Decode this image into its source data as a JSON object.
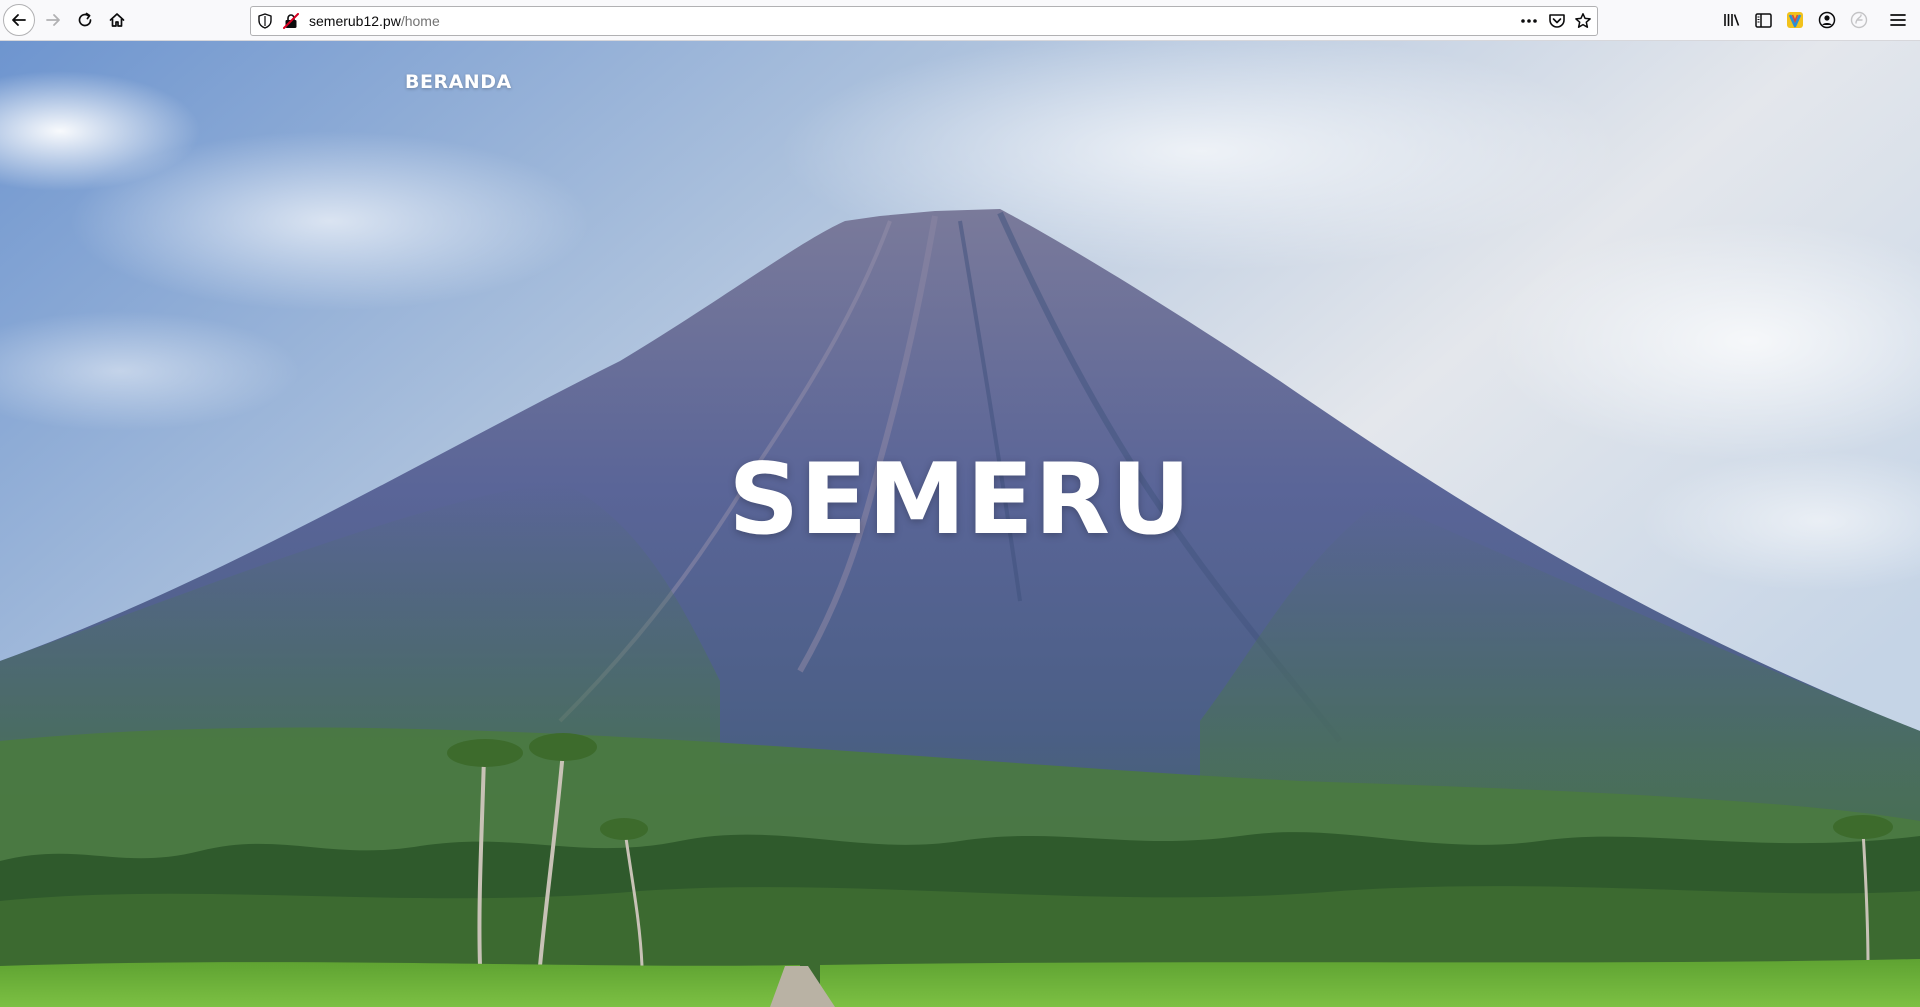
{
  "browser": {
    "url_domain": "semerub12.pw",
    "url_path": "/home",
    "icons": {
      "back": "arrow-left-icon",
      "forward": "arrow-right-icon",
      "reload": "reload-icon",
      "home": "home-icon",
      "tracking": "shield-icon",
      "insecure": "insecure-connection-icon",
      "page_actions": "more-horizontal-icon",
      "pocket": "pocket-icon",
      "bookmark": "star-icon",
      "library": "library-icon",
      "sidebar": "sidebar-icon",
      "extension": "extension-icon",
      "account": "account-icon",
      "extension2": "extension-icon",
      "menu": "hamburger-menu-icon"
    }
  },
  "page": {
    "nav": {
      "home_label": "BERANDA"
    },
    "hero": {
      "title": "SEMERU"
    }
  },
  "colors": {
    "sky": "#8fb0d6",
    "mountain": "#4f5f95",
    "forest": "#3f6a3a",
    "rice_field": "#6ab43a",
    "text": "#ffffff"
  }
}
